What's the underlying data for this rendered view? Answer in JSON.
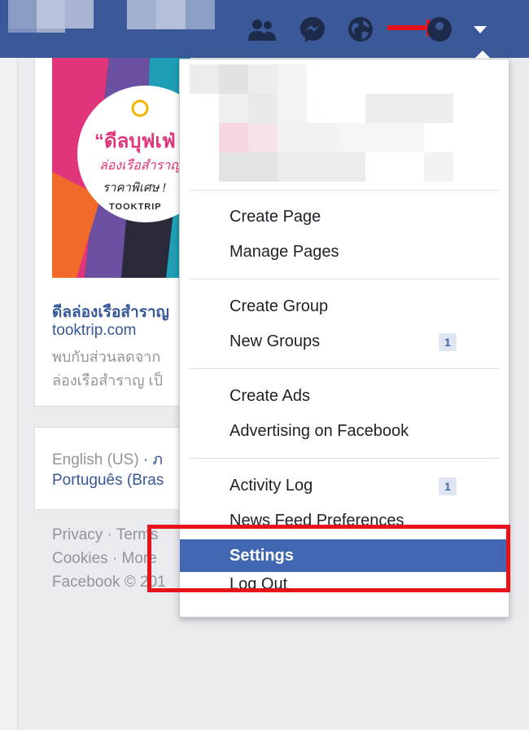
{
  "topbar": {
    "icons": [
      "friend-requests-icon",
      "messenger-icon",
      "notifications-globe-icon",
      "account-menu-icon"
    ],
    "arrow_color": "#e8121a"
  },
  "ad": {
    "image_headline": "“ดีลบุฟเฟ่",
    "image_subline_1": "ล่องเรือสำราญ",
    "image_subline_2": "ราคาพิเศษ !",
    "image_logo": "TOOKTRIP",
    "title": "ดีลล่องเรือสำราญ",
    "domain": "tooktrip.com",
    "desc_line_1": "พบกับส่วนลดจาก",
    "desc_line_2": "ล่องเรือสำราญ เป็"
  },
  "languages": {
    "line_1_current": "English (US)",
    "line_1_sep": " · ภ",
    "line_2": "Português (Bras"
  },
  "footer": {
    "line_1": "Privacy · Terms",
    "line_2": "Cookies · More",
    "line_3": "Facebook © 201"
  },
  "menu": {
    "groups": [
      {
        "items": [
          {
            "label": "Create Page"
          },
          {
            "label": "Manage Pages"
          }
        ]
      },
      {
        "items": [
          {
            "label": "Create Group"
          },
          {
            "label": "New Groups",
            "badge": "1"
          }
        ]
      },
      {
        "items": [
          {
            "label": "Create Ads"
          },
          {
            "label": "Advertising on Facebook"
          }
        ]
      },
      {
        "items": [
          {
            "label": "Activity Log",
            "badge": "1"
          },
          {
            "label": "News Feed Preferences"
          },
          {
            "label": "Settings",
            "active": true
          },
          {
            "label": "Log Out"
          }
        ]
      }
    ]
  },
  "colors": {
    "facebook_blue": "#3b5998",
    "highlight_blue": "#4267b2",
    "annotation_red": "#e8121a"
  }
}
